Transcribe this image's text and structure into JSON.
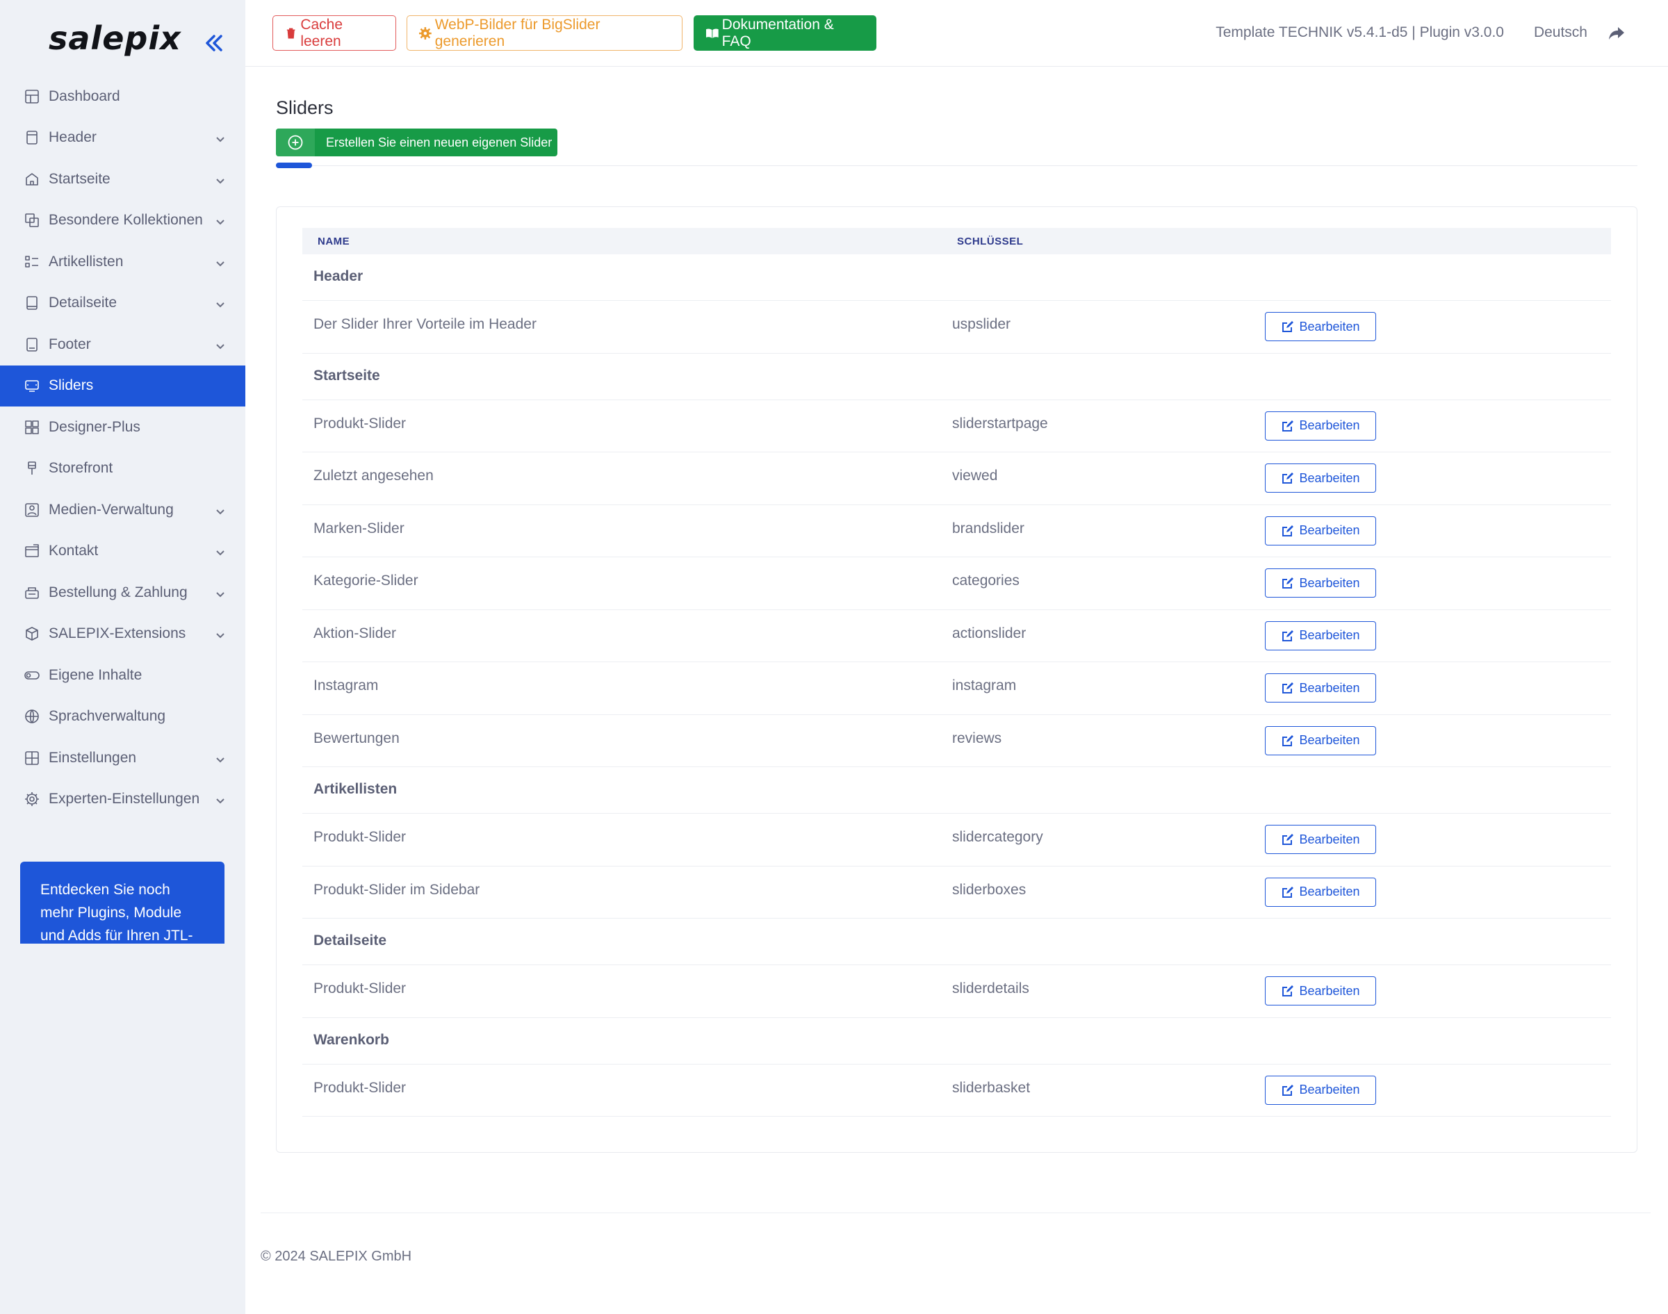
{
  "app": {
    "logo": "salepix"
  },
  "sidebar": {
    "items": [
      {
        "label": "Dashboard",
        "icon": "layout-icon",
        "chevron": false
      },
      {
        "label": "Header",
        "icon": "header-icon",
        "chevron": true
      },
      {
        "label": "Startseite",
        "icon": "home-icon",
        "chevron": true
      },
      {
        "label": "Besondere Kollektionen",
        "icon": "collections-icon",
        "chevron": true
      },
      {
        "label": "Artikellisten",
        "icon": "list-icon",
        "chevron": true
      },
      {
        "label": "Detailseite",
        "icon": "page-icon",
        "chevron": true
      },
      {
        "label": "Footer",
        "icon": "footer-icon",
        "chevron": true
      },
      {
        "label": "Sliders",
        "icon": "slider-icon",
        "chevron": false,
        "active": true
      },
      {
        "label": "Designer-Plus",
        "icon": "designer-icon",
        "chevron": false
      },
      {
        "label": "Storefront",
        "icon": "brush-icon",
        "chevron": false
      },
      {
        "label": "Medien-Verwaltung",
        "icon": "image-icon",
        "chevron": true
      },
      {
        "label": "Kontakt",
        "icon": "mail-icon",
        "chevron": true
      },
      {
        "label": "Bestellung & Zahlung",
        "icon": "order-icon",
        "chevron": true
      },
      {
        "label": "SALEPIX-Extensions",
        "icon": "package-icon",
        "chevron": true
      },
      {
        "label": "Eigene Inhalte",
        "icon": "toggle-icon",
        "chevron": false
      },
      {
        "label": "Sprachverwaltung",
        "icon": "globe-icon",
        "chevron": false
      },
      {
        "label": "Einstellungen",
        "icon": "grid-icon",
        "chevron": true
      },
      {
        "label": "Experten-Einstellungen",
        "icon": "gear-icon",
        "chevron": true
      }
    ],
    "promo": "Entdecken Sie noch mehr Plugins, Module und Adds für Ihren JTL-Shop"
  },
  "topbar": {
    "cache_label": "Cache leeren",
    "webp_label": "WebP-Bilder für BigSlider generieren",
    "doc_label": "Dokumentation & FAQ",
    "version": "Template TECHNIK v5.4.1-d5 | Plugin v3.0.0",
    "language": "Deutsch"
  },
  "main": {
    "title": "Sliders",
    "create_label": "Erstellen Sie einen neuen eigenen Slider",
    "table": {
      "col_name": "NAME",
      "col_key": "SCHLÜSSEL",
      "edit_label": "Bearbeiten",
      "groups": [
        {
          "title": "Header",
          "rows": [
            {
              "name": "Der Slider Ihrer Vorteile im Header",
              "key": "uspslider"
            }
          ]
        },
        {
          "title": "Startseite",
          "rows": [
            {
              "name": "Produkt-Slider",
              "key": "sliderstartpage"
            },
            {
              "name": "Zuletzt angesehen",
              "key": "viewed"
            },
            {
              "name": "Marken-Slider",
              "key": "brandslider"
            },
            {
              "name": "Kategorie-Slider",
              "key": "categories"
            },
            {
              "name": "Aktion-Slider",
              "key": "actionslider"
            },
            {
              "name": "Instagram",
              "key": "instagram"
            },
            {
              "name": "Bewertungen",
              "key": "reviews"
            }
          ]
        },
        {
          "title": "Artikellisten",
          "rows": [
            {
              "name": "Produkt-Slider",
              "key": "slidercategory"
            },
            {
              "name": "Produkt-Slider im Sidebar",
              "key": "sliderboxes"
            }
          ]
        },
        {
          "title": "Detailseite",
          "rows": [
            {
              "name": "Produkt-Slider",
              "key": "sliderdetails"
            }
          ]
        },
        {
          "title": "Warenkorb",
          "rows": [
            {
              "name": "Produkt-Slider",
              "key": "sliderbasket"
            }
          ]
        }
      ]
    }
  },
  "footer": {
    "copyright": "© 2024 SALEPIX GmbH"
  },
  "colors": {
    "accent": "#1e56d9",
    "success": "#179b47",
    "danger": "#d93c3c",
    "warning": "#ec9a2c",
    "sidebar_bg": "#eef1f6"
  }
}
